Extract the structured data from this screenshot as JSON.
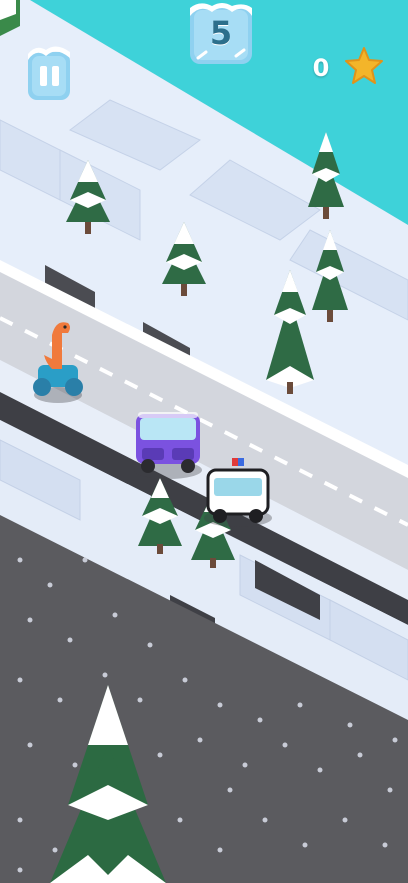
{
  "hud": {
    "score": "5",
    "coins": "0",
    "pause_icon": "pause-icon",
    "star_icon": "star-icon"
  },
  "colors": {
    "water": "#3fd0d8",
    "snow": "#e7eef9",
    "road": "#cfd3da",
    "ground": "#5a5a5e",
    "star": "#f3b52a",
    "purple_car": "#7b52e0",
    "dino": "#f07a3c"
  }
}
